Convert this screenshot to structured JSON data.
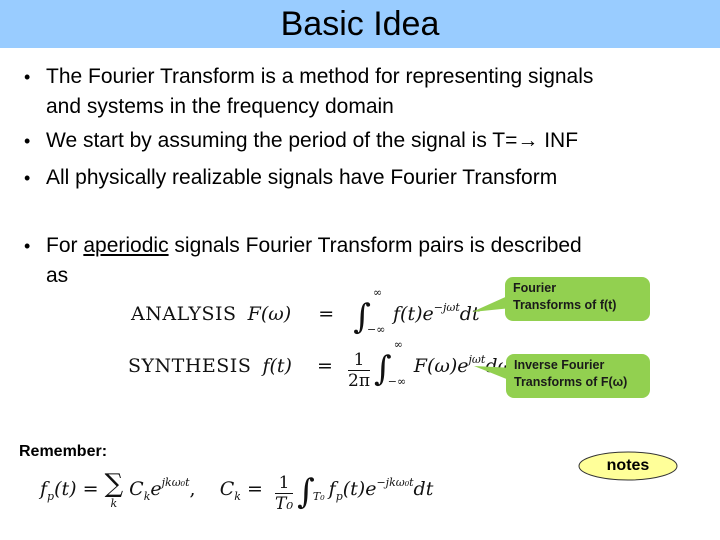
{
  "slide": {
    "title": "Basic Idea",
    "bullets": [
      {
        "line1": "The Fourier Transform is a method for representing signals",
        "line2": "and systems in the frequency domain"
      },
      {
        "line1": "We start by assuming the period of the signal is T=",
        "arrow": "→",
        "tail": " INF"
      },
      {
        "line1": "All physically realizable signals have Fourier Transform"
      },
      {
        "prefix": "For ",
        "underlined": "aperiodic",
        "suffix": " signals Fourier Transform pairs is described",
        "line2": "as"
      }
    ],
    "bullet_glyph": "•",
    "equations": {
      "analysis": {
        "label": "ANALYSIS",
        "lhs": "F(ω)",
        "eq": "=",
        "upper": "∞",
        "lower": "−∞",
        "integrand": "f(t)e",
        "exponent": "−jωt",
        "differential": "dt"
      },
      "synthesis": {
        "label": "SYNTHESIS",
        "lhs": "f(t)",
        "eq": "=",
        "frac_num": "1",
        "frac_den": "2π",
        "upper": "∞",
        "lower": "−∞",
        "integrand": "F(ω)e",
        "exponent": "jωt",
        "differential": "dω"
      },
      "fourier_series": {
        "lhs": "f",
        "lhs_sub": "p",
        "lhs_arg": "(t) = ",
        "sum": "∑",
        "sum_sub": "k",
        "term": "C",
        "term_sub": "k",
        "term_e": "e",
        "term_exp": "jkω₀t",
        "sep": ",   ",
        "ck": "C",
        "ck_sub": "k",
        "ck_eq": " = ",
        "frac_num": "1",
        "frac_den": "T₀",
        "int_sub": "T₀",
        "integrand": "f",
        "integrand_sub": "p",
        "integrand_arg": "(t)e",
        "integrand_exp": "−jkω₀t",
        "differential": "dt"
      }
    },
    "callouts": {
      "analysis": {
        "line1": "Fourier",
        "line2": "Transforms of f(t)"
      },
      "synthesis": {
        "line1": "Inverse Fourier",
        "line2": "Transforms of F(ω)"
      }
    },
    "remember_label": "Remember:",
    "notes_button": "notes",
    "colors": {
      "title_bar": "#99ccff",
      "callout": "#92d050",
      "notes_fill": "#ffff99"
    }
  }
}
